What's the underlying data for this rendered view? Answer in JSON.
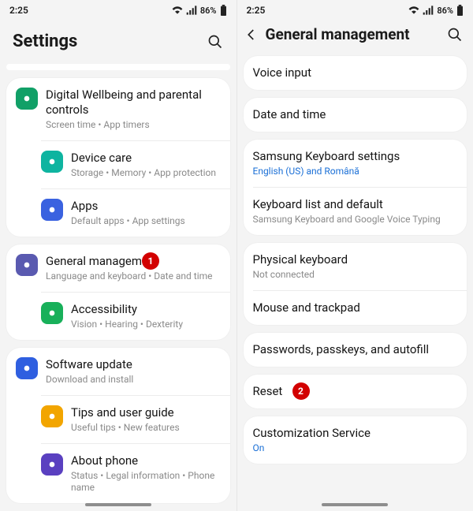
{
  "status": {
    "time": "2:25",
    "battery": "86%"
  },
  "left": {
    "title": "Settings",
    "groups": [
      {
        "items": [
          {
            "icon": "#11a067",
            "label": "Digital Wellbeing and parental controls",
            "sub": "Screen time  •  App timers"
          },
          {
            "icon": "#0eb4a0",
            "label": "Device care",
            "sub": "Storage  •  Memory  •  App protection"
          },
          {
            "icon": "#3a62e0",
            "label": "Apps",
            "sub": "Default apps  •  App settings"
          }
        ]
      },
      {
        "items": [
          {
            "icon": "#5a5ab0",
            "label": "General management",
            "sub": "Language and keyboard  •  Date and time",
            "marker": "1"
          },
          {
            "icon": "#18b05a",
            "label": "Accessibility",
            "sub": "Vision  •  Hearing  •  Dexterity"
          }
        ]
      },
      {
        "items": [
          {
            "icon": "#2f5fe0",
            "label": "Software update",
            "sub": "Download and install"
          },
          {
            "icon": "#f2a500",
            "label": "Tips and user guide",
            "sub": "Useful tips  •  New features"
          },
          {
            "icon": "#5a40c0",
            "label": "About phone",
            "sub": "Status  •  Legal information  •  Phone name"
          }
        ]
      }
    ]
  },
  "right": {
    "title": "General management",
    "groups": [
      {
        "items": [
          {
            "label": "Voice input"
          }
        ]
      },
      {
        "items": [
          {
            "label": "Date and time"
          }
        ]
      },
      {
        "items": [
          {
            "label": "Samsung Keyboard settings",
            "sub": "English (US) and Română",
            "subClass": "blue"
          },
          {
            "label": "Keyboard list and default",
            "sub": "Samsung Keyboard and Google Voice Typing"
          }
        ]
      },
      {
        "items": [
          {
            "label": "Physical keyboard",
            "sub": "Not connected"
          },
          {
            "label": "Mouse and trackpad"
          }
        ]
      },
      {
        "items": [
          {
            "label": "Passwords, passkeys, and autofill"
          }
        ]
      },
      {
        "items": [
          {
            "label": "Reset",
            "marker": "2"
          }
        ]
      },
      {
        "items": [
          {
            "label": "Customization Service",
            "sub": "On",
            "subClass": "blue"
          }
        ]
      }
    ]
  }
}
